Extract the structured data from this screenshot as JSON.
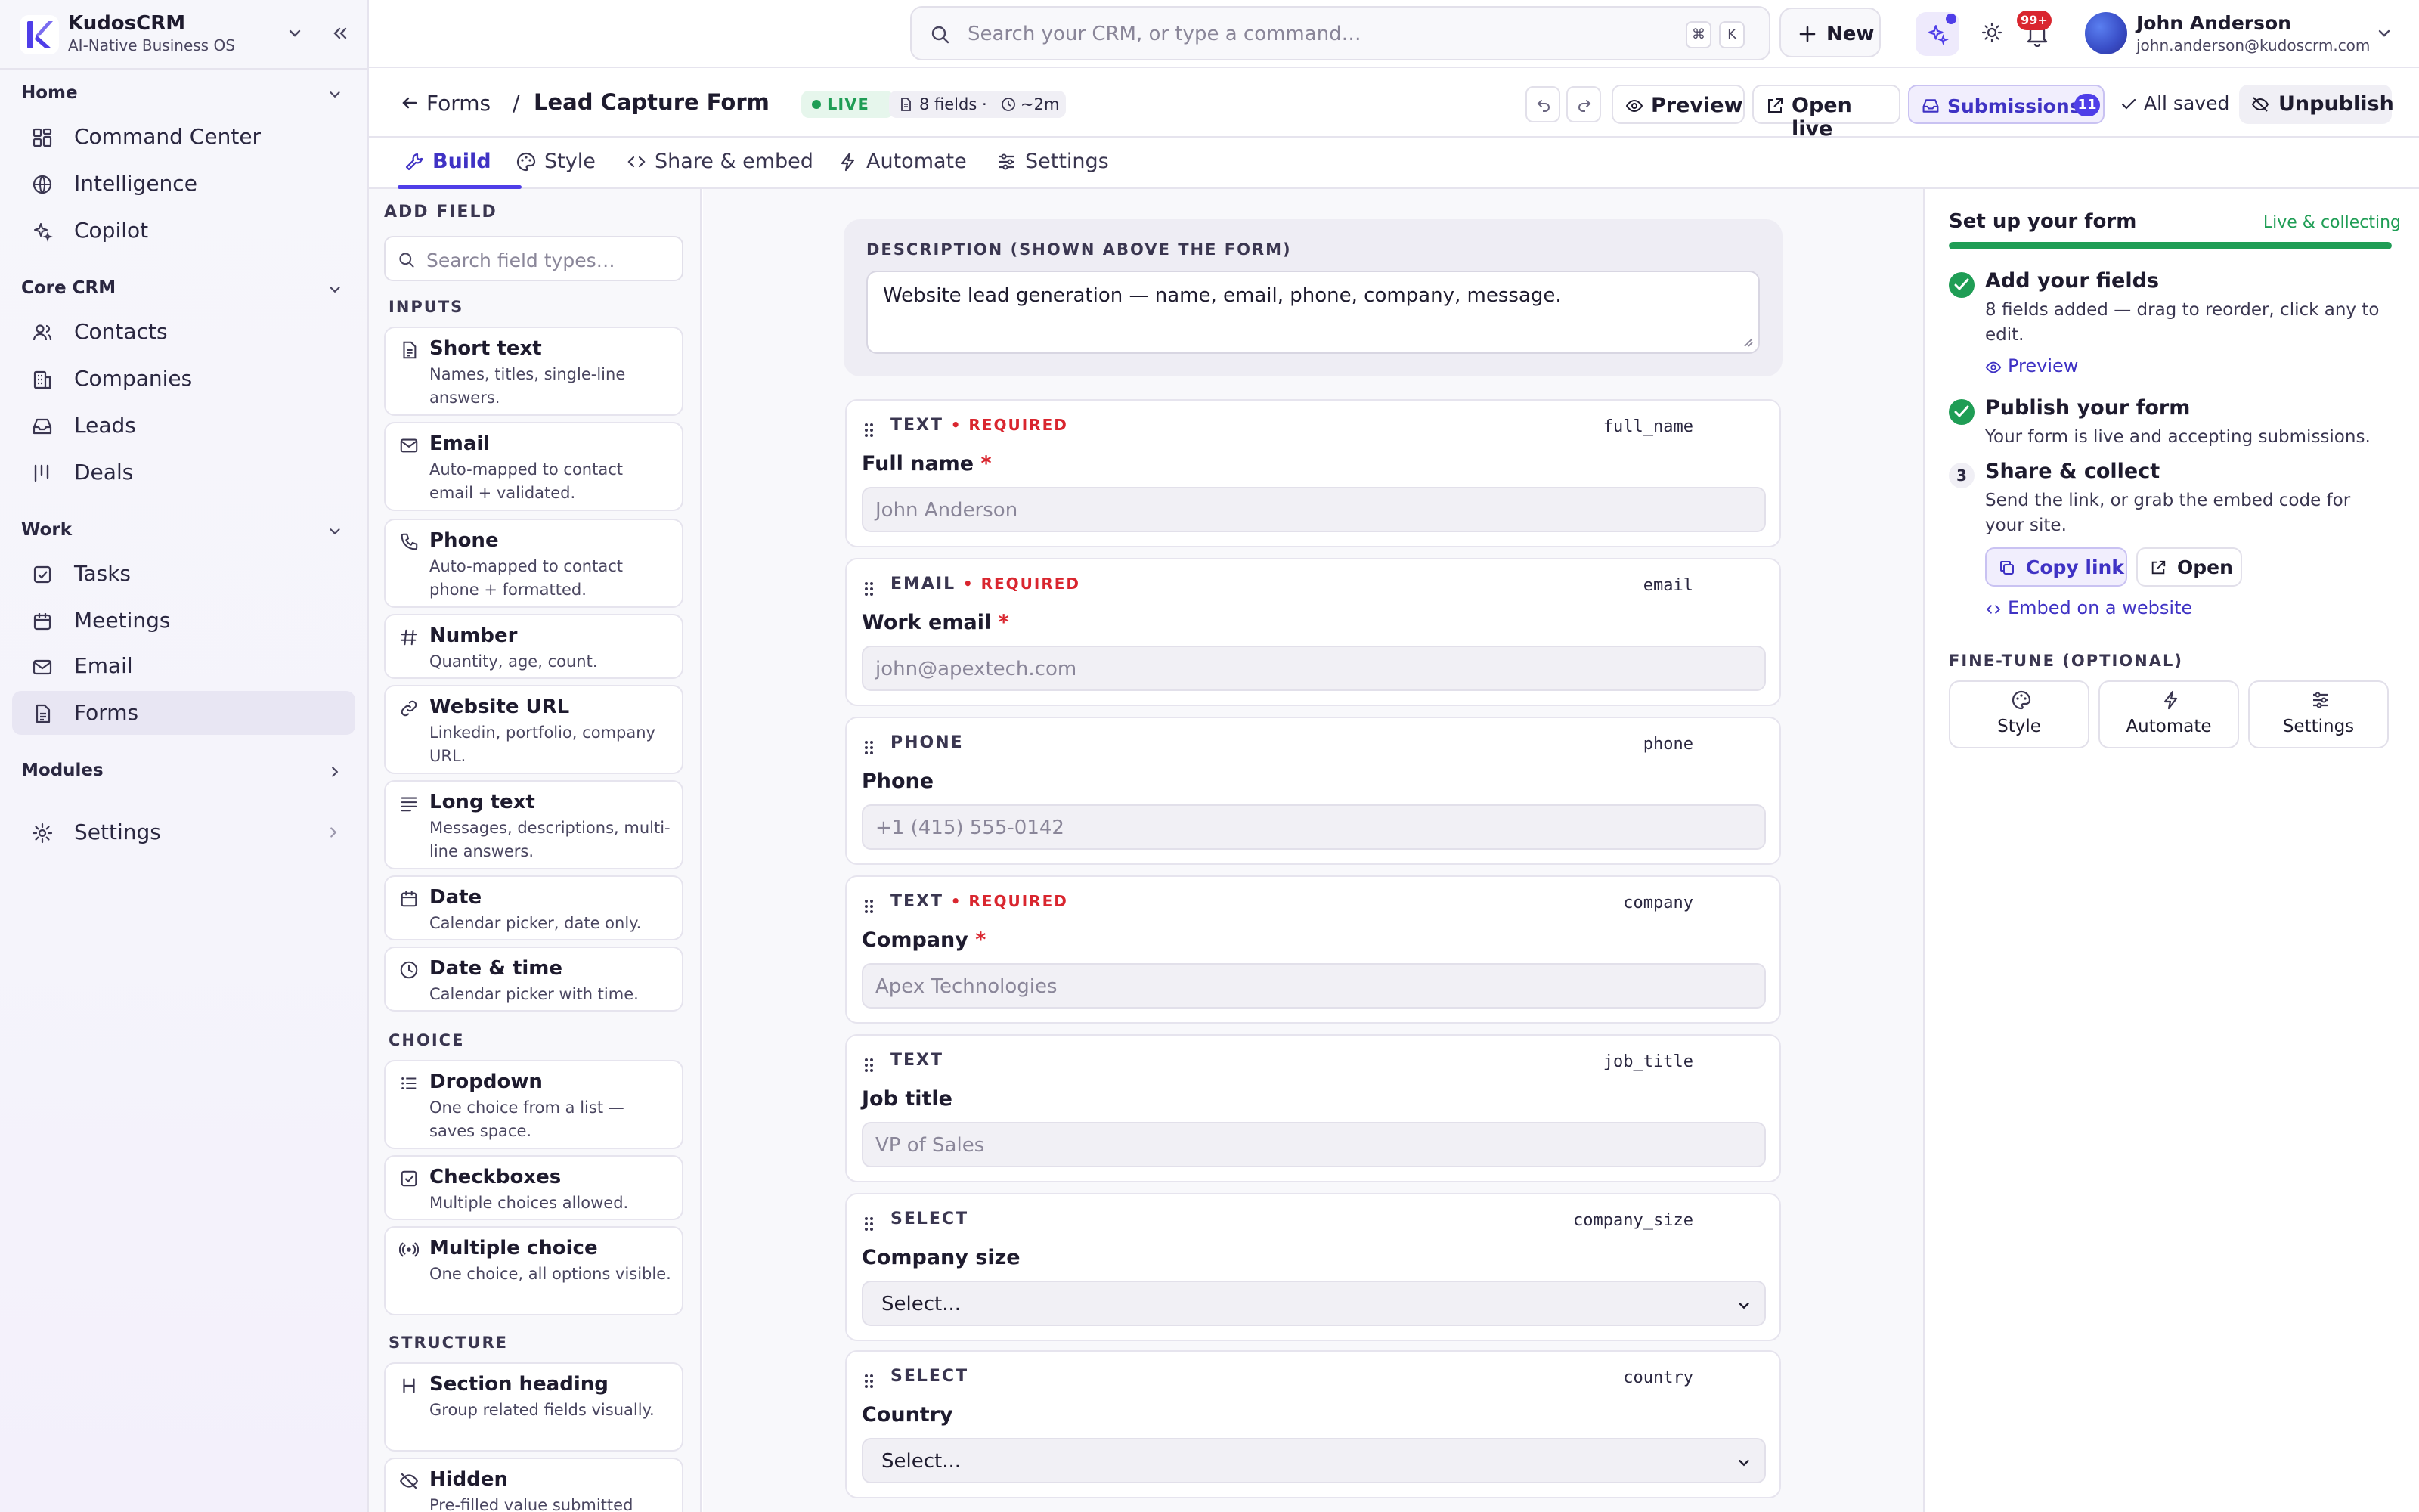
{
  "app": {
    "name": "KudosCRM",
    "tagline": "AI-Native Business OS"
  },
  "sidebar": {
    "sections": [
      {
        "label": "Home"
      },
      {
        "label": "Core CRM"
      },
      {
        "label": "Work"
      },
      {
        "label": "Modules"
      }
    ],
    "items": [
      {
        "label": "Command Center",
        "icon": "grid-icon"
      },
      {
        "label": "Intelligence",
        "icon": "globe-icon"
      },
      {
        "label": "Copilot",
        "icon": "sparkle-icon"
      },
      {
        "label": "Contacts",
        "icon": "users-icon"
      },
      {
        "label": "Companies",
        "icon": "building-icon"
      },
      {
        "label": "Leads",
        "icon": "inbox-icon"
      },
      {
        "label": "Deals",
        "icon": "kanban-icon"
      },
      {
        "label": "Tasks",
        "icon": "checkbox-icon"
      },
      {
        "label": "Meetings",
        "icon": "calendar-icon"
      },
      {
        "label": "Email",
        "icon": "mail-icon"
      },
      {
        "label": "Forms",
        "icon": "document-icon",
        "active": true
      }
    ],
    "settings_label": "Settings"
  },
  "topbar": {
    "search_placeholder": "Search your CRM, or type a command…",
    "kbd_cmd": "⌘",
    "kbd_k": "K",
    "new_label": "New",
    "notif_badge": "99+",
    "user_name": "John Anderson",
    "user_email": "john.anderson@kudoscrm.com"
  },
  "formhead": {
    "back_label": "Forms",
    "separator": "/",
    "title": "Lead Capture Form",
    "status": "LIVE",
    "fields_count": "8 fields ·",
    "duration": "~2m",
    "preview_label": "Preview",
    "open_live_label": "Open live",
    "submissions_label": "Submissions",
    "submissions_count": "11",
    "saved_label": "All saved",
    "unpublish_label": "Unpublish"
  },
  "tabs": [
    {
      "label": "Build",
      "active": true
    },
    {
      "label": "Style"
    },
    {
      "label": "Share & embed"
    },
    {
      "label": "Automate"
    },
    {
      "label": "Settings"
    }
  ],
  "addfield": {
    "title": "ADD FIELD",
    "search_placeholder": "Search field types…",
    "groups": [
      "INPUTS",
      "CHOICE",
      "STRUCTURE"
    ],
    "types": [
      {
        "name": "Short text",
        "desc": "Names, titles, single-line answers."
      },
      {
        "name": "Email",
        "desc": "Auto-mapped to contact email + validated."
      },
      {
        "name": "Phone",
        "desc": "Auto-mapped to contact phone + formatted."
      },
      {
        "name": "Number",
        "desc": "Quantity, age, count."
      },
      {
        "name": "Website URL",
        "desc": "Linkedin, portfolio, company URL."
      },
      {
        "name": "Long text",
        "desc": "Messages, descriptions, multi-line answers."
      },
      {
        "name": "Date",
        "desc": "Calendar picker, date only."
      },
      {
        "name": "Date & time",
        "desc": "Calendar picker with time."
      },
      {
        "name": "Dropdown",
        "desc": "One choice from a list — saves space."
      },
      {
        "name": "Checkboxes",
        "desc": "Multiple choices allowed."
      },
      {
        "name": "Multiple choice",
        "desc": "One choice, all options visible."
      },
      {
        "name": "Section heading",
        "desc": "Group related fields visually."
      },
      {
        "name": "Hidden",
        "desc": "Pre-filled value submitted"
      }
    ]
  },
  "canvas": {
    "description_label": "DESCRIPTION (SHOWN ABOVE THE FORM)",
    "description_value": "Website lead generation — name, email, phone, company, message.",
    "required_tag": "• REQUIRED",
    "fields": [
      {
        "type": "TEXT",
        "required": true,
        "key": "full_name",
        "label": "Full name",
        "placeholder": "John Anderson"
      },
      {
        "type": "EMAIL",
        "required": true,
        "key": "email",
        "label": "Work email",
        "placeholder": "john@apextech.com"
      },
      {
        "type": "PHONE",
        "required": false,
        "key": "phone",
        "label": "Phone",
        "placeholder": "+1 (415) 555-0142"
      },
      {
        "type": "TEXT",
        "required": true,
        "key": "company",
        "label": "Company",
        "placeholder": "Apex Technologies"
      },
      {
        "type": "TEXT",
        "required": false,
        "key": "job_title",
        "label": "Job title",
        "placeholder": "VP of Sales"
      },
      {
        "type": "SELECT",
        "required": false,
        "key": "company_size",
        "label": "Company size",
        "value": "Select..."
      },
      {
        "type": "SELECT",
        "required": false,
        "key": "country",
        "label": "Country",
        "value": "Select..."
      }
    ]
  },
  "setup": {
    "title": "Set up your form",
    "status": "Live & collecting",
    "progress": 1.0,
    "steps": [
      {
        "title": "Add your fields",
        "desc": "8 fields added — drag to reorder, click any to edit.",
        "done": true
      },
      {
        "title": "Publish your form",
        "desc": "Your form is live and accepting submissions.",
        "done": true
      },
      {
        "num": "3",
        "title": "Share & collect",
        "desc": "Send the link, or grab the embed code for your site.",
        "done": false
      }
    ],
    "preview_link": "Preview",
    "copy_link_label": "Copy link",
    "open_label": "Open",
    "embed_link": "Embed on a website",
    "finetune_label": "FINE-TUNE (OPTIONAL)",
    "finetune": [
      {
        "label": "Style"
      },
      {
        "label": "Automate"
      },
      {
        "label": "Settings"
      }
    ]
  },
  "colors": {
    "accent": "#4f3ee8",
    "live": "#1f9d55",
    "required": "#d9262f"
  }
}
